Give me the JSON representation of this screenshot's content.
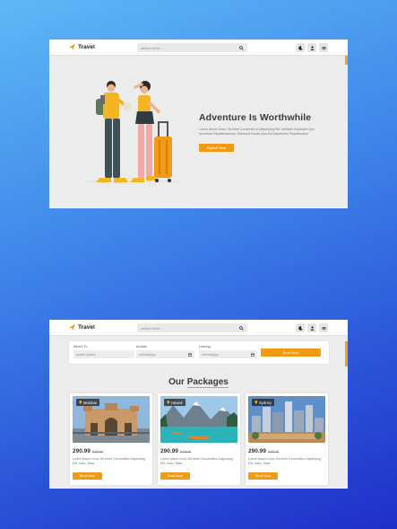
{
  "nav": {
    "brand": "Travel",
    "search_placeholder": "search here..."
  },
  "hero": {
    "title": "Adventure Is Worthwhile",
    "description": "Lorem ipsum Dolor Sit Amet Consectet ur Adipisicing Elit. Veritatis Explicabo Quo Inventore Repellendusnet. Reiciuna Facilis Ipsa Est Asperiores Repellendusl",
    "button": "Explore Now"
  },
  "booking": {
    "where_label": "Where To",
    "where_placeholder": "search places",
    "arrivals_label": "Arrivals",
    "leaving_label": "Leaving",
    "date_placeholder": "mm/dd/yyyy",
    "button": "Book Now"
  },
  "packages": {
    "title_part1": "Our",
    "title_part2": "Packages",
    "cards": [
      {
        "location": "Mumbai",
        "price": "290.99",
        "old_price": "$399.99",
        "description": "Lorem Ipsum Dolor Sit Amet Consectetur Adipisicing Elit. Iusto, Vitae.",
        "button": "Book Now"
      },
      {
        "location": "Hawaii",
        "price": "290.99",
        "old_price": "$399.99",
        "description": "Lorem Ipsum Dolor Sit Amet Consectetur Adipisicing Elit. Iusto, Vitae.",
        "button": "Book Now"
      },
      {
        "location": "Sydney",
        "price": "290.99",
        "old_price": "$399.99",
        "description": "Lorem Ipsum Dolor Sit Amet Consectetur Adipisicing Elit. Iusto, Vitae.",
        "button": "Book Now"
      }
    ]
  },
  "colors": {
    "accent": "#f39a14",
    "background_top": "#5fb8f5",
    "background_bottom": "#1f2fc8"
  },
  "icons": [
    "plane-icon",
    "search-icon",
    "moon-icon",
    "user-icon",
    "menu-icon",
    "calendar-icon",
    "map-pin-icon"
  ]
}
